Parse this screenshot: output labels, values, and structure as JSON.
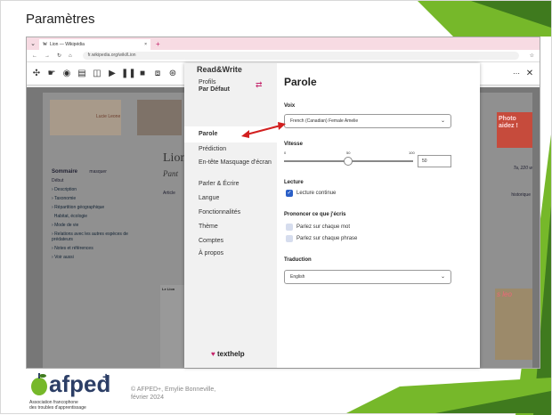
{
  "slide": {
    "title": "Paramètres",
    "colors": {
      "green": "#76b82a",
      "dark_green": "#3f7a1e"
    },
    "footer": {
      "logo_word": "afped",
      "logo_plus": "+",
      "logo_sub_1": "Association francophone",
      "logo_sub_2": "des troubles d'apprentissage",
      "copyright_1": "© AFPED+,  Emylie  Bonneville,",
      "copyright_2": "février 2024"
    }
  },
  "browser": {
    "tab_title": "Lion — Wikipédia",
    "tab_close": "×",
    "new_tab": "+",
    "url": "fr.wikipedia.org/wiki/Lion"
  },
  "wikipedia": {
    "logo_caption": "Lucie Leone",
    "title": "Lion",
    "subtitle": "Pant",
    "sommaire": "Sommaire",
    "masquer": "masquer",
    "toc": [
      "Début",
      "Description",
      "Taxonomie",
      "Répartition géographique",
      "Habitat, écologie",
      "Mode de vie",
      "Relations avec les autres espèces de prédateurs",
      "Notes et références",
      "Voir aussi"
    ],
    "article_tab": "Article",
    "foot_bold": "Le Lion",
    "photo_badge": "Photo aidez !",
    "side_text": "Ta, 220 w",
    "side_link": "historique",
    "food_badge": "s leo"
  },
  "readwrite": {
    "brand": "Read&Write",
    "profiles_label": "Profils",
    "profile_value": "Par Défaut",
    "nav": [
      "Parole",
      "Prédiction",
      "En-tête Masquage d'écran",
      "Parler & Écrire",
      "Langue",
      "Fonctionnalités",
      "Thème",
      "Comptes",
      "À propos"
    ],
    "active_nav": "Parole",
    "footer_brand": "texthelp",
    "panel_title": "Parole",
    "voice_label": "Voix",
    "voice_value": "French (Canadian) Female Amelie",
    "speed_label": "Vitesse",
    "speed_ticks": [
      "0",
      "50",
      "100"
    ],
    "speed_value": "50",
    "reading_label": "Lecture",
    "continuous_reading": "Lecture continue",
    "continuous_checked": true,
    "pronounce_label": "Prononcer ce que j'écris",
    "speak_each_word": "Parlez sur chaque mot",
    "speak_each_sentence": "Parlez sur chaque phrase",
    "translation_label": "Traduction",
    "translation_value": "English"
  }
}
